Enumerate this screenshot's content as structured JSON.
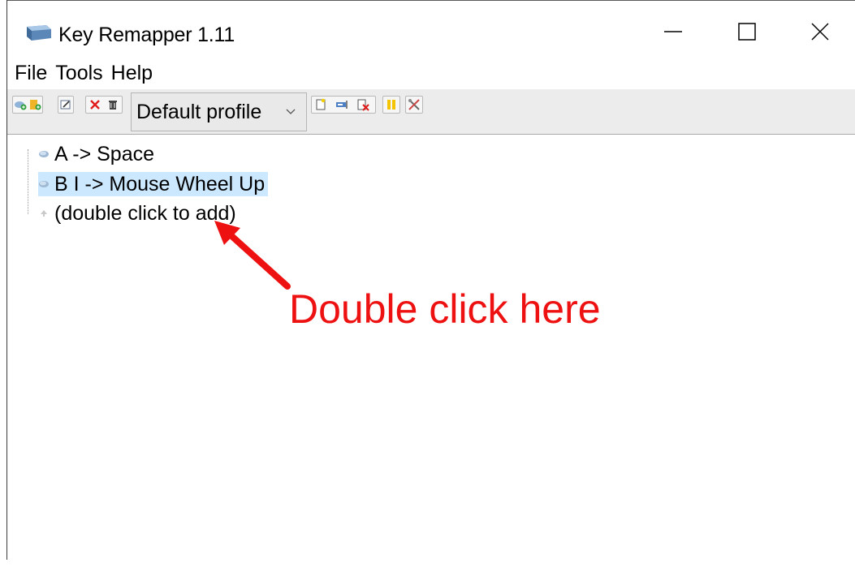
{
  "window": {
    "title": "Key Remapper 1.11",
    "icon": "keycap-icon"
  },
  "title_buttons": {
    "minimize_glyph": "—",
    "maximize_icon": "square-icon",
    "close_icon": "x-icon"
  },
  "menu": {
    "items": [
      {
        "label": "File"
      },
      {
        "label": "Tools"
      },
      {
        "label": "Help"
      }
    ]
  },
  "toolbar": {
    "left_group_icons": [
      "add-keycap-icon",
      "add-folder-icon"
    ],
    "edit_group_icons": [
      "edit-icon",
      "delete-red-x-icon",
      "trash-icon"
    ],
    "profile_select": {
      "value": "Default profile"
    },
    "profile_group_icons": [
      "new-profile-icon",
      "rename-profile-icon",
      "delete-profile-icon"
    ],
    "pause_icon": "pause-icon",
    "settings_icon": "settings-tools-icon"
  },
  "tree": {
    "items": [
      {
        "label": "A -> Space",
        "selected": false
      },
      {
        "label": "B I -> Mouse Wheel Up",
        "selected": true
      },
      {
        "label": "(double click to add)",
        "selected": false
      }
    ]
  },
  "annotation": {
    "text": "Double click here",
    "color": "#ee1111"
  },
  "colors": {
    "selection": "#cce8ff",
    "toolbar_bg": "#ececec"
  }
}
